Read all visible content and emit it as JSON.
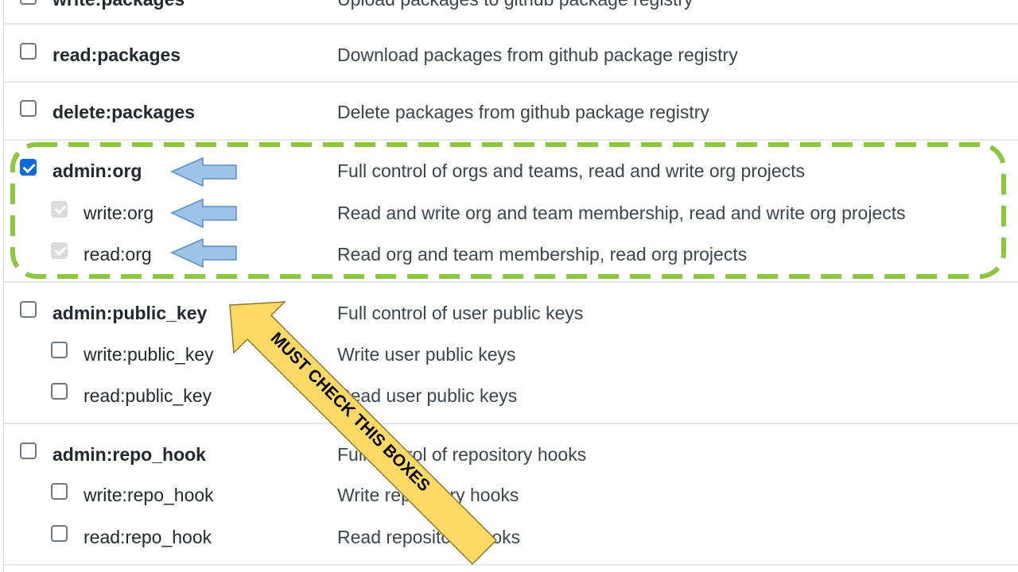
{
  "scopes": {
    "write_packages": {
      "label": "write:packages",
      "description": "Upload packages to github package registry"
    },
    "read_packages": {
      "label": "read:packages",
      "description": "Download packages from github package registry"
    },
    "delete_packages": {
      "label": "delete:packages",
      "description": "Delete packages from github package registry"
    },
    "admin_org": {
      "label": "admin:org",
      "description": "Full control of orgs and teams, read and write org projects",
      "checked": true
    },
    "write_org": {
      "label": "write:org",
      "description": "Read and write org and team membership, read and write org projects",
      "checked": true,
      "disabled": true
    },
    "read_org": {
      "label": "read:org",
      "description": "Read org and team membership, read org projects",
      "checked": true,
      "disabled": true
    },
    "admin_public_key": {
      "label": "admin:public_key",
      "description": "Full control of user public keys"
    },
    "write_public_key": {
      "label": "write:public_key",
      "description": "Write user public keys"
    },
    "read_public_key": {
      "label": "read:public_key",
      "description": "Read user public keys"
    },
    "admin_repo_hook": {
      "label": "admin:repo_hook",
      "description": "Full control of repository hooks"
    },
    "write_repo_hook": {
      "label": "write:repo_hook",
      "description": "Write repository hooks"
    },
    "read_repo_hook": {
      "label": "read:repo_hook",
      "description": "Read repository hooks"
    }
  },
  "annotation": {
    "callout_text": "MUST CHECK THIS BOXES",
    "highlight_color": "#8dc63f",
    "arrow_fill": "#ffd966",
    "small_arrow_fill": "#9dc3e6",
    "small_arrow_stroke": "#5b8fc7"
  },
  "colors": {
    "checkbox_checked": "#0969da",
    "checkbox_disabled": "#dcdcdc",
    "divider": "#e6e8eb"
  }
}
